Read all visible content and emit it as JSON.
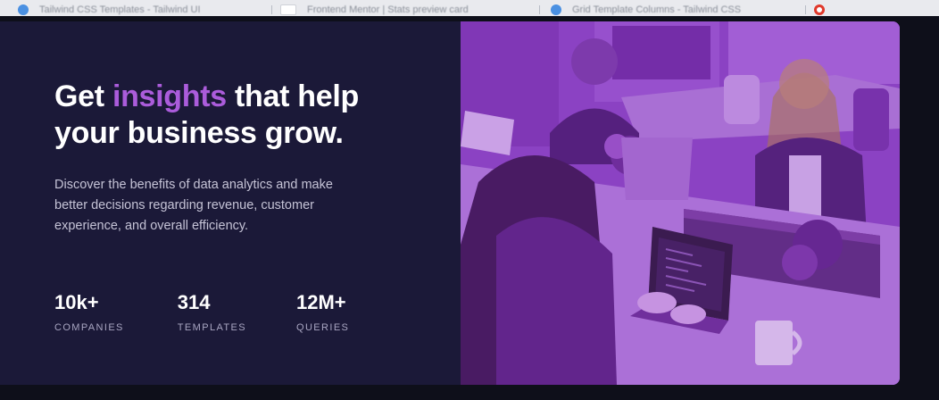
{
  "browser_tabs": [
    {
      "label": "Tailwind CSS Templates - Tailwind UI"
    },
    {
      "label": "Frontend Mentor | Stats preview card"
    },
    {
      "label": "Grid Template Columns - Tailwind CSS"
    },
    {
      "label": ""
    }
  ],
  "card": {
    "headline_pre": "Get ",
    "headline_accent": "insights",
    "headline_post": " that help your business grow.",
    "description": "Discover the benefits of data analytics and make better decisions regarding revenue, customer experience, and overall efficiency.",
    "stats": [
      {
        "value": "10k+",
        "label": "COMPANIES"
      },
      {
        "value": "314",
        "label": "TEMPLATES"
      },
      {
        "value": "12M+",
        "label": "QUERIES"
      }
    ]
  },
  "colors": {
    "card_background": "#1b1938",
    "accent": "#ab5cdb",
    "page_background": "#0e0f1a",
    "image_overlay": "#8a3fc0"
  },
  "image": {
    "icon": "office-workers-photo"
  }
}
